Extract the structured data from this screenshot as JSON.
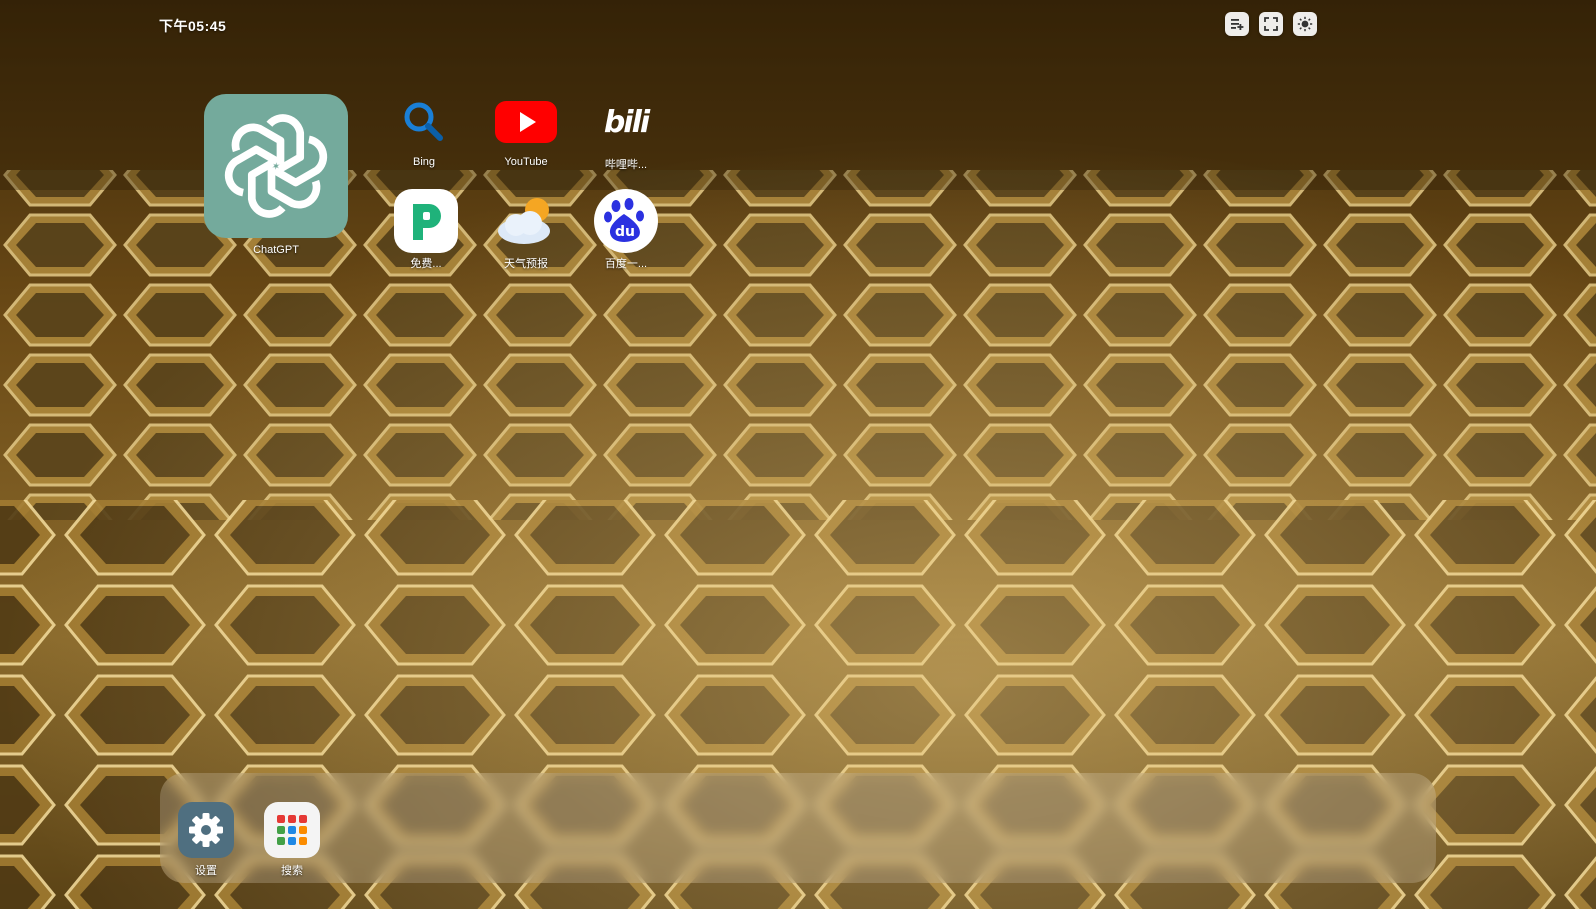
{
  "status": {
    "time": "下午05:45"
  },
  "top_controls": [
    {
      "name": "add-playlist-icon"
    },
    {
      "name": "fullscreen-icon"
    },
    {
      "name": "brightness-icon"
    }
  ],
  "apps": {
    "chatgpt": {
      "label": "ChatGPT",
      "color": "#74aa9c"
    },
    "bing": {
      "label": "Bing"
    },
    "youtube": {
      "label": "YouTube",
      "color": "#ff0000"
    },
    "bilibili": {
      "label": "哔哩哔..."
    },
    "free_novel": {
      "label": "免费..."
    },
    "weather": {
      "label": "天气预报"
    },
    "baidu": {
      "label": "百度一..."
    }
  },
  "dock": {
    "settings": {
      "label": "设置"
    },
    "search": {
      "label": "搜索"
    }
  }
}
